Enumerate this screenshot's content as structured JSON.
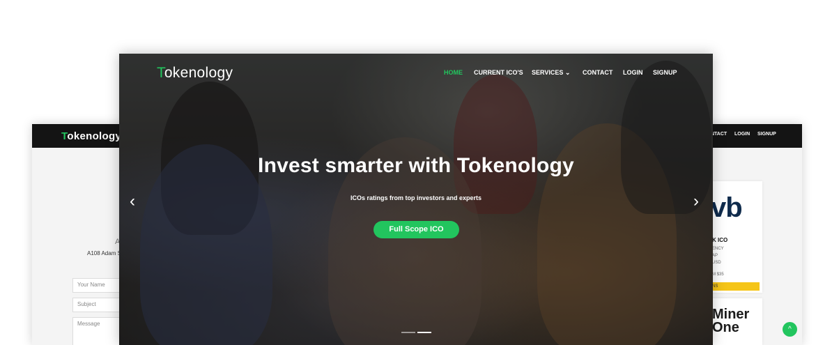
{
  "brand": {
    "first_letter": "T",
    "rest": "okenology",
    "accent": "#22c55e"
  },
  "main_nav": {
    "items": [
      {
        "label": "HOME",
        "active": true
      },
      {
        "label": "CURRENT ICO'S"
      },
      {
        "label": "SERVICES"
      },
      {
        "label": "CONTACT"
      },
      {
        "label": "LOGIN"
      },
      {
        "label": "SIGNUP"
      }
    ],
    "services_caret": "⌄"
  },
  "hero": {
    "title": "Invest smarter with Tokenology",
    "subtitle": "ICOs ratings from top investors and experts",
    "cta_label": "Full Scope ICO",
    "prev_icon": "‹",
    "next_icon": "›"
  },
  "left_window": {
    "address_letter": "A",
    "address_line": "A108 Adam S",
    "fields": {
      "name": "Your Name",
      "subject": "Subject",
      "message": "Message"
    }
  },
  "right_window": {
    "nav": {
      "contact_partial": "NTACT",
      "login": "LOGIN",
      "signup": "SIGNUP"
    },
    "card": {
      "logo": "vb",
      "title": "K ICO",
      "lines": [
        "ENCY",
        "AP",
        "USD",
        "M $35"
      ],
      "button_partial": "NS"
    },
    "miner": {
      "line1": "Miner",
      "line2": "One"
    },
    "scroll_top_icon": "^"
  }
}
